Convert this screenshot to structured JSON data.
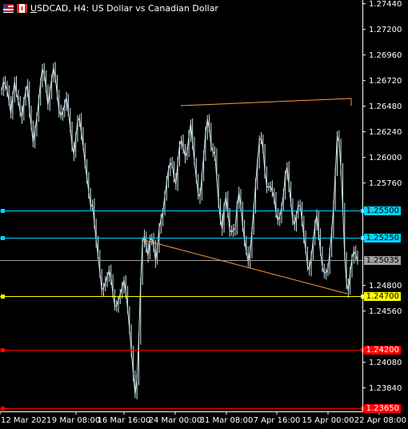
{
  "title": "USDCAD, H4:  US Dollar vs Canadian Dollar",
  "title_prefix": "U",
  "title_rest": "SDCAD, H4:  US Dollar vs Canadian Dollar",
  "icons": [
    "us-flag-icon",
    "ca-flag-icon"
  ],
  "colors": {
    "background": "#000000",
    "axis": "#ffffff",
    "candle": "#cde4e8",
    "cyan_line": "#00d4ff",
    "gray_line": "#a0a0a0",
    "yellow_line": "#ffff00",
    "red_line": "#ff0000",
    "trend_line": "#ff9b3d"
  },
  "y_axis_ticks": [
    "1.27440",
    "1.27200",
    "1.26960",
    "1.26720",
    "1.26480",
    "1.26240",
    "1.26000",
    "1.25760",
    "1.24800",
    "1.24560",
    "1.24080",
    "1.23840"
  ],
  "x_axis_ticks": [
    "12 Mar 2021",
    "9 Mar 08:00",
    "16 Mar 16:00",
    "24 Mar 00:00",
    "31 Mar 08:00",
    "7 Apr 16:00",
    "15 Apr 00:00",
    "22 Apr 08:00"
  ],
  "price_lines": [
    {
      "name": "price-line-1-25500",
      "label": "1.25500",
      "value": 1.255,
      "color": "#00d4ff",
      "label_bg": "#00d4ff",
      "label_fg": "#000000",
      "marker": true
    },
    {
      "name": "price-line-1-25250",
      "label": "1.25250",
      "value": 1.2525,
      "color": "#00d4ff",
      "label_bg": "#00d4ff",
      "label_fg": "#000000",
      "marker": true
    },
    {
      "name": "price-line-1-25035",
      "label": "1.25035",
      "value": 1.25035,
      "color": "#a0a0a0",
      "label_bg": "#a0a0a0",
      "label_fg": "#000000",
      "marker": false
    },
    {
      "name": "price-line-1-24700",
      "label": "1.24700",
      "value": 1.247,
      "color": "#ffff00",
      "label_bg": "#ffff00",
      "label_fg": "#000000",
      "marker": true
    },
    {
      "name": "price-line-1-24200",
      "label": "1.24200",
      "value": 1.242,
      "color": "#ff0000",
      "label_bg": "#ff0000",
      "label_fg": "#ffffff",
      "marker": true
    },
    {
      "name": "price-line-1-23650",
      "label": "1.23650",
      "value": 1.2365,
      "color": "#ff0000",
      "label_bg": "#ff0000",
      "label_fg": "#ffffff",
      "marker": true
    }
  ],
  "chart_data": {
    "type": "line",
    "title": "USDCAD, H4:  US Dollar vs Canadian Dollar",
    "xlabel": "",
    "ylabel": "",
    "ylim": [
      1.2362,
      1.2746
    ],
    "x_ticks": [
      "12 Mar 2021",
      "9 Mar 08:00",
      "16 Mar 16:00",
      "24 Mar 00:00",
      "31 Mar 08:00",
      "7 Apr 16:00",
      "15 Apr 00:00",
      "22 Apr 08:00"
    ],
    "y_ticks": [
      1.2744,
      1.272,
      1.2696,
      1.2672,
      1.2648,
      1.2624,
      1.26,
      1.2576,
      1.248,
      1.2456,
      1.2408,
      1.2384
    ],
    "grid": false,
    "series_close": [
      1.2662,
      1.2671,
      1.2668,
      1.2663,
      1.2652,
      1.2641,
      1.2658,
      1.2671,
      1.266,
      1.2653,
      1.2643,
      1.2638,
      1.2653,
      1.2662,
      1.2668,
      1.2644,
      1.2629,
      1.2614,
      1.2626,
      1.2637,
      1.2653,
      1.2671,
      1.2683,
      1.2678,
      1.2664,
      1.2649,
      1.2661,
      1.2674,
      1.2684,
      1.2674,
      1.2659,
      1.2644,
      1.2639,
      1.2643,
      1.265,
      1.2656,
      1.2642,
      1.2628,
      1.2611,
      1.2603,
      1.2619,
      1.2634,
      1.2637,
      1.2623,
      1.261,
      1.2594,
      1.2581,
      1.2568,
      1.2554,
      1.2556,
      1.2539,
      1.2522,
      1.2508,
      1.2492,
      1.2476,
      1.2478,
      1.2483,
      1.2489,
      1.2494,
      1.2487,
      1.2472,
      1.2461,
      1.2461,
      1.2466,
      1.2472,
      1.2478,
      1.2485,
      1.2474,
      1.2457,
      1.2439,
      1.2418,
      1.2397,
      1.2378,
      1.2392,
      1.2431,
      1.2484,
      1.252,
      1.2527,
      1.2516,
      1.2508,
      1.2522,
      1.2525,
      1.2517,
      1.2503,
      1.2515,
      1.2534,
      1.2542,
      1.2549,
      1.2564,
      1.2577,
      1.2589,
      1.2595,
      1.2593,
      1.2581,
      1.2575,
      1.2595,
      1.2612,
      1.2616,
      1.2609,
      1.2601,
      1.2605,
      1.262,
      1.2632,
      1.2614,
      1.2596,
      1.258,
      1.2566,
      1.2563,
      1.2582,
      1.2602,
      1.2623,
      1.2636,
      1.2627,
      1.261,
      1.2606,
      1.2603,
      1.2581,
      1.2557,
      1.2542,
      1.2533,
      1.2554,
      1.2563,
      1.2549,
      1.2532,
      1.253,
      1.2532,
      1.2534,
      1.2555,
      1.2567,
      1.2554,
      1.2536,
      1.2523,
      1.2512,
      1.2502,
      1.2512,
      1.2531,
      1.2552,
      1.2575,
      1.2596,
      1.2616,
      1.2618,
      1.2608,
      1.2586,
      1.2573,
      1.2572,
      1.2573,
      1.2568,
      1.2563,
      1.2547,
      1.2541,
      1.2545,
      1.2553,
      1.2565,
      1.2584,
      1.2591,
      1.2574,
      1.2557,
      1.2541,
      1.2537,
      1.2546,
      1.2555,
      1.2555,
      1.2541,
      1.2526,
      1.2513,
      1.2498,
      1.2495,
      1.2507,
      1.2522,
      1.2537,
      1.2546,
      1.2529,
      1.2511,
      1.2497,
      1.2492,
      1.2492,
      1.2495,
      1.2512,
      1.2531,
      1.2554,
      1.2587,
      1.262,
      1.2614,
      1.259,
      1.2552,
      1.2508,
      1.2482,
      1.2475,
      1.2492,
      1.2506,
      1.2512,
      1.2509,
      1.2503
    ]
  }
}
